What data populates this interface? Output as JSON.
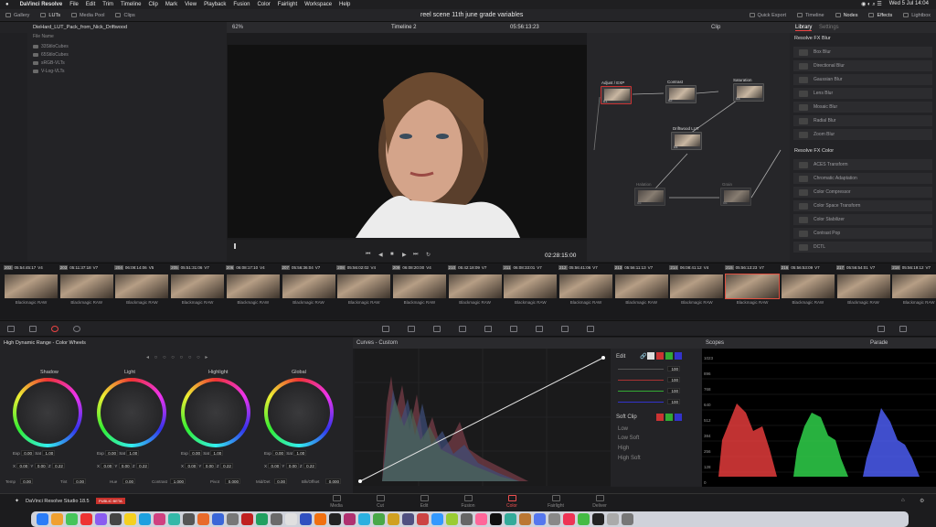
{
  "menubar": {
    "apple": "",
    "app": "DaVinci Resolve",
    "items": [
      "File",
      "Edit",
      "Trim",
      "Timeline",
      "Clip",
      "Mark",
      "View",
      "Playback",
      "Fusion",
      "Color",
      "Fairlight",
      "Workspace",
      "Help"
    ],
    "clock": "Wed 5 Jul  14:04"
  },
  "toolbar": {
    "gallery": "Gallery",
    "luts": "LUTs",
    "media_pool": "Media Pool",
    "clips": "Clips",
    "project_title": "reel scene 11th june grade variables",
    "quick_export": "Quick Export",
    "timeline": "Timeline",
    "nodes": "Nodes",
    "effects": "Effects",
    "lightbox": "Lightbox"
  },
  "lut_panel": {
    "path": "DieHard_LUT_Pack_from_Nick_Driftwood",
    "column": "File Name",
    "folders": [
      "33StiloCubes",
      "65StiloCubes",
      "sRGB-VLTs",
      "V-Log-VLTs"
    ]
  },
  "viewer": {
    "zoom": "62%",
    "timeline_name": "Timeline 2",
    "timecode": "05:56:13:23",
    "duration": "02:28:15:00"
  },
  "nodes_panel": {
    "mode": "Clip",
    "nodes": [
      {
        "label": "Adjust / EXP",
        "num": "01"
      },
      {
        "label": "Contrast",
        "num": "02"
      },
      {
        "label": "Saturation",
        "num": "03"
      },
      {
        "label": "Driftwood LUT",
        "num": "04"
      },
      {
        "label": "Halation",
        "num": "05"
      },
      {
        "label": "Grain",
        "num": "06"
      }
    ]
  },
  "library": {
    "tab_library": "Library",
    "tab_settings": "Settings",
    "section1": "Resolve FX Blur",
    "blur_items": [
      "Box Blur",
      "Directional Blur",
      "Gaussian Blur",
      "Lens Blur",
      "Mosaic Blur",
      "Radial Blur",
      "Zoom Blur"
    ],
    "section2": "Resolve FX Color",
    "color_items": [
      "ACES Transform",
      "Chromatic Adaptation",
      "Color Compressor",
      "Color Space Transform",
      "Color Stabilizer",
      "Contrast Pop",
      "DCTL"
    ]
  },
  "clips": [
    {
      "num": "202",
      "tc": "05:54:45:17",
      "track": "V4",
      "codec": "Blackmagic RAW"
    },
    {
      "num": "203",
      "tc": "05:11:37:18",
      "track": "V7",
      "codec": "Blackmagic RAW"
    },
    {
      "num": "204",
      "tc": "06:08:14:06",
      "track": "V5",
      "codec": "Blackmagic RAW"
    },
    {
      "num": "205",
      "tc": "05:51:31:06",
      "track": "V7",
      "codec": "Blackmagic RAW"
    },
    {
      "num": "206",
      "tc": "06:08:17:10",
      "track": "V4",
      "codec": "Blackmagic RAW"
    },
    {
      "num": "207",
      "tc": "05:56:36:04",
      "track": "V7",
      "codec": "Blackmagic RAW"
    },
    {
      "num": "208",
      "tc": "05:56:02:02",
      "track": "V4",
      "codec": "Blackmagic RAW"
    },
    {
      "num": "209",
      "tc": "06:08:20:00",
      "track": "V4",
      "codec": "Blackmagic RAW"
    },
    {
      "num": "210",
      "tc": "05:42:18:09",
      "track": "V7",
      "codec": "Blackmagic RAW"
    },
    {
      "num": "211",
      "tc": "06:08:33:01",
      "track": "V7",
      "codec": "Blackmagic RAW"
    },
    {
      "num": "212",
      "tc": "05:56:41:06",
      "track": "V7",
      "codec": "Blackmagic RAW"
    },
    {
      "num": "213",
      "tc": "05:56:11:13",
      "track": "V7",
      "codec": "Blackmagic RAW"
    },
    {
      "num": "214",
      "tc": "06:08:41:12",
      "track": "V4",
      "codec": "Blackmagic RAW"
    },
    {
      "num": "215",
      "tc": "05:56:13:23",
      "track": "V7",
      "codec": "Blackmagic RAW"
    },
    {
      "num": "216",
      "tc": "05:56:53:09",
      "track": "V7",
      "codec": "Blackmagic RAW"
    },
    {
      "num": "217",
      "tc": "05:56:54:01",
      "track": "V7",
      "codec": "Blackmagic RAW"
    },
    {
      "num": "218",
      "tc": "05:56:19:12",
      "track": "V7",
      "codec": "Blackmagic RAW"
    }
  ],
  "wheels": {
    "panel_title": "High Dynamic Range - Color Wheels",
    "names": [
      "Shadow",
      "Light",
      "Highlight",
      "Global"
    ],
    "exp": "0.00",
    "sat": "1.00",
    "x": "0.00",
    "y": "0.00",
    "z": "0.22",
    "temp_label": "Temp",
    "temp": "0.00",
    "tint_label": "Tint",
    "tint": "0.00",
    "hue_label": "Hue",
    "hue": "0.00",
    "contrast_label": "Contrast",
    "contrast": "1.000",
    "pivot_label": "Pivot",
    "pivot": "0.000",
    "middet_label": "Mid/Det",
    "middet": "0.00",
    "bo_label": "Blk/Offset",
    "bo": "0.000"
  },
  "curves": {
    "title": "Curves - Custom",
    "edit": "Edit",
    "values": [
      "100",
      "100",
      "100",
      "100"
    ],
    "soft_clip": "Soft Clip",
    "low": "Low",
    "low_soft": "Low Soft",
    "high": "High",
    "high_soft": "High Soft"
  },
  "scopes": {
    "title": "Scopes",
    "mode": "Parade",
    "ticks": [
      "1023",
      "896",
      "768",
      "640",
      "512",
      "384",
      "256",
      "128",
      "0"
    ]
  },
  "pages": [
    "Media",
    "Cut",
    "Edit",
    "Fusion",
    "Color",
    "Fairlight",
    "Deliver"
  ],
  "active_page": "Color",
  "version": "DaVinci Resolve Studio 18.5",
  "badge": "PUBLIC BETA"
}
